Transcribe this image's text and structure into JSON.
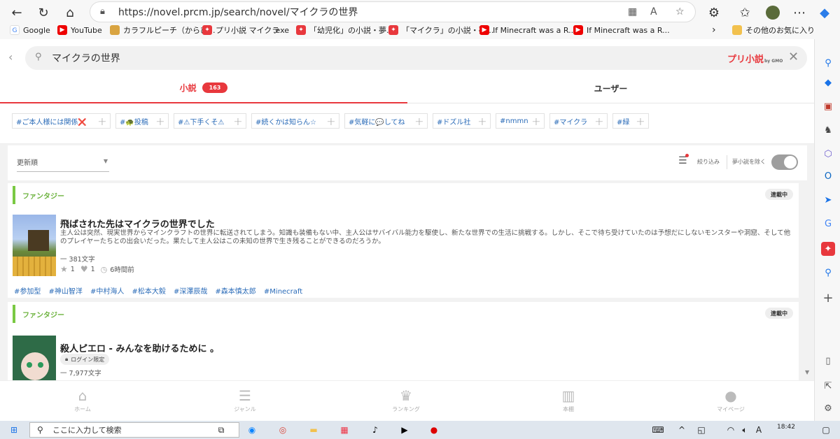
{
  "browser": {
    "url": "https://novel.prcm.jp/search/novel/マイクラの世界",
    "bookmarks": [
      {
        "label": "Google"
      },
      {
        "label": "YouTube"
      },
      {
        "label": "カラフルピーチ（からぴ..."
      },
      {
        "label": "プリ小説 マイクラ"
      },
      {
        "label": ".exe"
      },
      {
        "label": "「幼児化」の小説・夢..."
      },
      {
        "label": "「マイクラ」の小説・夢..."
      },
      {
        "label": "If Minecraft was a R..."
      },
      {
        "label": "If Minecraft was a R..."
      }
    ],
    "other_bookmarks": "その他のお気に入り"
  },
  "search": {
    "query": "マイクラの世界",
    "logo_text": "プリ小説",
    "logo_sub": "by GMO"
  },
  "tabs": [
    {
      "label": "小説",
      "count": "163",
      "active": true
    },
    {
      "label": "ユーザー",
      "active": false
    }
  ],
  "tag_chips": [
    {
      "label": "#ご本人様には関係❌"
    },
    {
      "label": "#🐢投稿"
    },
    {
      "label": "#⚠下手くそ⚠"
    },
    {
      "label": "#続くかは知らん☆"
    },
    {
      "label": "#気軽に💬してね"
    },
    {
      "label": "#ドズル社"
    },
    {
      "label": "#nmmn"
    },
    {
      "label": "#マイクラ"
    },
    {
      "label": "#緑"
    }
  ],
  "filter": {
    "sort_label": "更新順",
    "refine_label": "絞り込み",
    "exclude_label": "夢小説を除く"
  },
  "novels": [
    {
      "genre": "ファンタジー",
      "status": "連載中",
      "title": "飛ばされた先はマイクラの世界でした",
      "description": "主人公は突然、現実世界からマインクラフトの世界に転送されてしまう。知識も装備もない中、主人公はサバイバル能力を駆使し、新たな世界での生活に挑戦する。しかし、そこで待ち受けていたのは予想だにしないモンスターや洞窟、そして他のプレイヤーたちとの出会いだった。果たして主人公はこの未知の世界で生き残ることができるのだろうか。",
      "chars": "一 381文字",
      "stars": "1",
      "hearts": "1",
      "updated": "6時間前",
      "tags": [
        "#参加型",
        "#神山智洋",
        "#中村海人",
        "#松本大毅",
        "#深澤辰哉",
        "#森本慎太郎",
        "#Minecraft"
      ]
    },
    {
      "genre": "ファンタジー",
      "status": "連載中",
      "title": "殺人ピエロ - みんなを助けるために 。",
      "login_badge": "ログイン限定",
      "chars": "一 7,977文字"
    }
  ],
  "bottom_nav": [
    {
      "label": "ホーム",
      "icon": "home-icon"
    },
    {
      "label": "ジャンル",
      "icon": "list-icon"
    },
    {
      "label": "ランキング",
      "icon": "crown-icon"
    },
    {
      "label": "本棚",
      "icon": "bookshelf-icon"
    },
    {
      "label": "マイページ",
      "icon": "user-icon"
    }
  ],
  "taskbar": {
    "search_placeholder": "ここに入力して検索",
    "time": "18:42",
    "ime": "A"
  },
  "colors": {
    "accent": "#e8383d",
    "link": "#2a6bb8",
    "genre": "#6db33f"
  }
}
